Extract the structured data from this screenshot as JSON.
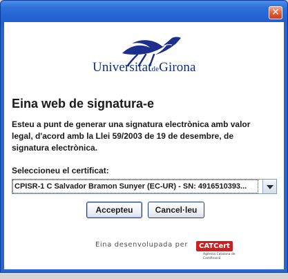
{
  "window": {
    "close_glyph": "✕",
    "title_color": "#2461d4",
    "close_color": "#e05a36"
  },
  "logo": {
    "name_prefix": "Universitat",
    "name_de": "de",
    "name_suffix": "Girona",
    "color": "#1c2f8c"
  },
  "heading": "Eina web de signatura-e",
  "description": "Esteu a punt de generar una signatura electrònica amb valor legal, d'acord amb la Llei 59/2003 de 19 de desembre, de signatura electrònica.",
  "certificate": {
    "label": "Seleccioneu el certificat:",
    "selected": "CPISR-1 C Salvador Bramon Sunyer (EC-UR) - SN: 4916510393..."
  },
  "buttons": {
    "accept": "Accepteu",
    "cancel": "Cancel·leu"
  },
  "footer": {
    "developed_by": "Eina desenvolupada per",
    "catcert_logo": "CATCert",
    "catcert_subtitle": "Agència Catalana de Certificació",
    "catcert_color": "#cc1f1f"
  }
}
